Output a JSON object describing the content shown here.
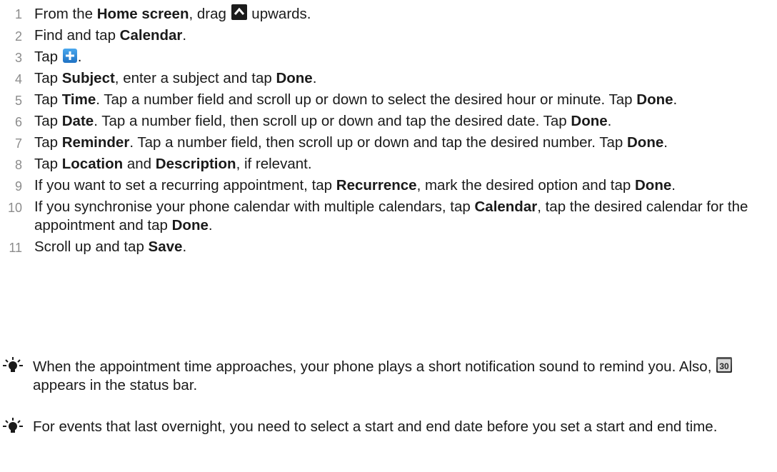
{
  "steps": [
    {
      "num": "1",
      "parts": [
        {
          "t": "From the "
        },
        {
          "t": "Home screen",
          "b": true
        },
        {
          "t": ", drag "
        },
        {
          "icon": "chevron-up-icon"
        },
        {
          "t": " upwards."
        }
      ]
    },
    {
      "num": "2",
      "parts": [
        {
          "t": "Find and tap "
        },
        {
          "t": "Calendar",
          "b": true
        },
        {
          "t": "."
        }
      ]
    },
    {
      "num": "3",
      "parts": [
        {
          "t": "Tap "
        },
        {
          "icon": "add-icon"
        },
        {
          "t": "."
        }
      ]
    },
    {
      "num": "4",
      "parts": [
        {
          "t": "Tap "
        },
        {
          "t": "Subject",
          "b": true
        },
        {
          "t": ", enter a subject and tap "
        },
        {
          "t": "Done",
          "b": true
        },
        {
          "t": "."
        }
      ]
    },
    {
      "num": "5",
      "parts": [
        {
          "t": "Tap "
        },
        {
          "t": "Time",
          "b": true
        },
        {
          "t": ". Tap a number field and scroll up or down to select the desired hour or minute. Tap "
        },
        {
          "t": "Done",
          "b": true
        },
        {
          "t": "."
        }
      ]
    },
    {
      "num": "6",
      "parts": [
        {
          "t": "Tap "
        },
        {
          "t": "Date",
          "b": true
        },
        {
          "t": ". Tap a number field, then scroll up or down and tap the desired date. Tap "
        },
        {
          "t": "Done",
          "b": true
        },
        {
          "t": "."
        }
      ]
    },
    {
      "num": "7",
      "parts": [
        {
          "t": "Tap "
        },
        {
          "t": "Reminder",
          "b": true
        },
        {
          "t": ". Tap a number field, then scroll up or down and tap the desired number. Tap "
        },
        {
          "t": "Done",
          "b": true
        },
        {
          "t": "."
        }
      ]
    },
    {
      "num": "8",
      "parts": [
        {
          "t": "Tap "
        },
        {
          "t": "Location",
          "b": true
        },
        {
          "t": " and "
        },
        {
          "t": "Description",
          "b": true
        },
        {
          "t": ", if relevant."
        }
      ]
    },
    {
      "num": "9",
      "parts": [
        {
          "t": "If you want to set a recurring appointment, tap "
        },
        {
          "t": "Recurrence",
          "b": true
        },
        {
          "t": ", mark the desired option and tap "
        },
        {
          "t": "Done",
          "b": true
        },
        {
          "t": "."
        }
      ]
    },
    {
      "num": "10",
      "parts": [
        {
          "t": "If you synchronise your phone calendar with multiple calendars, tap "
        },
        {
          "t": "Calendar",
          "b": true
        },
        {
          "t": ", tap the desired calendar for the appointment and tap "
        },
        {
          "t": "Done",
          "b": true
        },
        {
          "t": "."
        }
      ]
    },
    {
      "num": "11",
      "parts": [
        {
          "t": "Scroll up and tap "
        },
        {
          "t": "Save",
          "b": true
        },
        {
          "t": "."
        }
      ]
    }
  ],
  "notes": [
    {
      "parts": [
        {
          "t": "When the appointment time approaches, your phone plays a short notification sound to remind you. Also, "
        },
        {
          "icon": "calendar-30-icon",
          "label": "30"
        },
        {
          "t": " appears in the status bar."
        }
      ]
    },
    {
      "parts": [
        {
          "t": "For events that last overnight, you need to select a start and end date before you set a start and end time."
        }
      ]
    }
  ],
  "colors": {
    "text": "#1a1a1a",
    "step_number": "#8c8c8c",
    "tip_icon": "#1a1a1a",
    "add_icon": "#2a8be0"
  },
  "icons": [
    "chevron-up-icon",
    "add-icon",
    "calendar-30-icon",
    "lightbulb-icon"
  ]
}
